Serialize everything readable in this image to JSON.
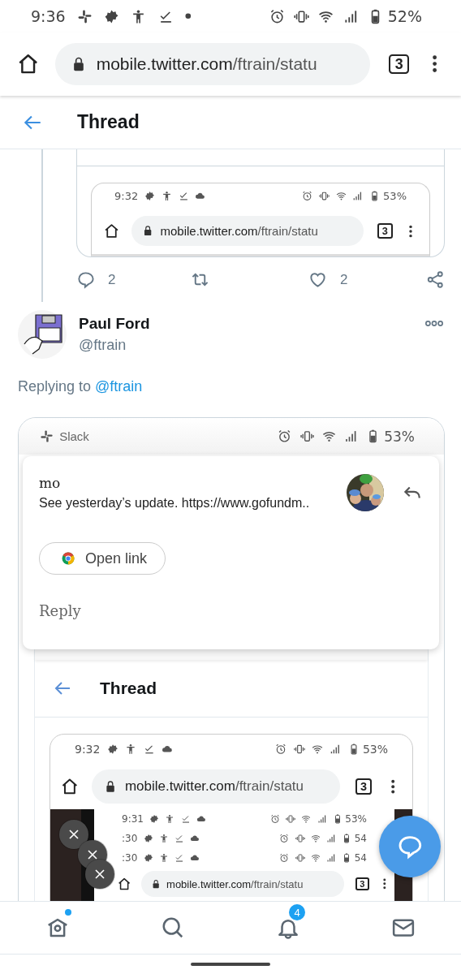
{
  "status_bar": {
    "time": "9:36",
    "battery": "52%"
  },
  "browser": {
    "host": "mobile.twitter.com",
    "path": "/ftrain/statu",
    "tab_count": "3"
  },
  "header": {
    "title": "Thread"
  },
  "quoted_tweet": {
    "screenshot": {
      "status_bar": {
        "time": "9:32",
        "battery": "53%"
      },
      "browser": {
        "host": "mobile.twitter.com",
        "path": "/ftrain/statu",
        "tab_count": "3"
      }
    },
    "actions": {
      "replies": "2",
      "likes": "2"
    }
  },
  "reply_tweet": {
    "name": "Paul Ford",
    "handle": "@ftrain",
    "replying_label": "Replying to",
    "replying_to": "@ftrain",
    "screenshot": {
      "status_bar": {
        "app": "Slack",
        "battery": "53%"
      },
      "notification": {
        "sender": "mo",
        "message": "See yesterday’s update. https://www.gofundm..",
        "action": "Open link",
        "reply": "Reply"
      },
      "page": {
        "header": {
          "title": "Thread"
        },
        "screenshot": {
          "status_bar": {
            "time": "9:32",
            "battery": "53%"
          },
          "browser": {
            "host": "mobile.twitter.com",
            "path": "/ftrain/statu",
            "tab_count": "3"
          },
          "stacked_status_bars": [
            {
              "time": "9:31",
              "battery": "53%"
            },
            {
              "time": ":30",
              "battery": "54"
            },
            {
              "time": ":30",
              "battery": "54"
            }
          ],
          "browser_2": {
            "host": "mobile.twitter.com",
            "path": "/ftrain/statu",
            "tab_count": "3"
          }
        }
      }
    }
  },
  "bottom_nav": [
    {
      "kind": "home",
      "new": true
    },
    {
      "kind": "search"
    },
    {
      "kind": "notifications",
      "badge": "4"
    },
    {
      "kind": "messages"
    }
  ]
}
